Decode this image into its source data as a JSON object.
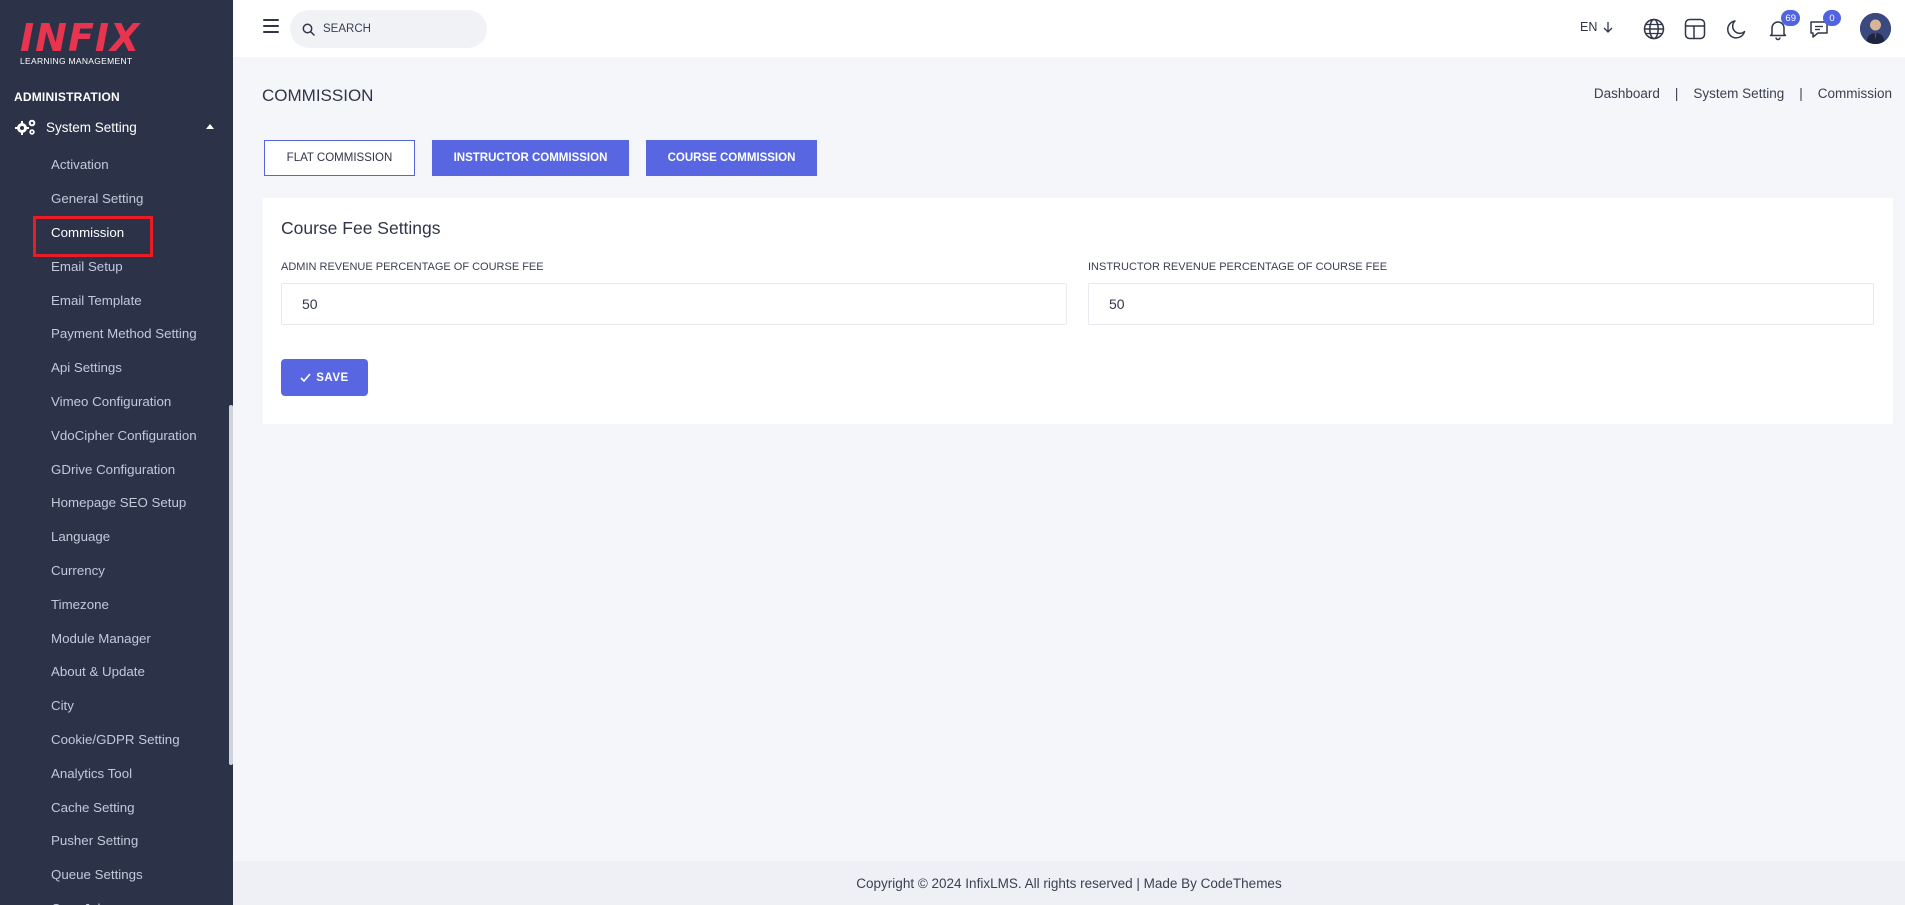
{
  "sidebar": {
    "logo_main": "INFIX",
    "logo_sub": "LEARNING MANAGEMENT",
    "section_title": "ADMINISTRATION",
    "parent_menu": "System Setting",
    "items": [
      {
        "label": "Activation"
      },
      {
        "label": "General Setting"
      },
      {
        "label": "Commission"
      },
      {
        "label": "Email Setup"
      },
      {
        "label": "Email Template"
      },
      {
        "label": "Payment Method Setting"
      },
      {
        "label": "Api Settings"
      },
      {
        "label": "Vimeo Configuration"
      },
      {
        "label": "VdoCipher Configuration"
      },
      {
        "label": "GDrive Configuration"
      },
      {
        "label": "Homepage SEO Setup"
      },
      {
        "label": "Language"
      },
      {
        "label": "Currency"
      },
      {
        "label": "Timezone"
      },
      {
        "label": "Module Manager"
      },
      {
        "label": "About & Update"
      },
      {
        "label": "City"
      },
      {
        "label": "Cookie/GDPR Setting"
      },
      {
        "label": "Analytics Tool"
      },
      {
        "label": "Cache Setting"
      },
      {
        "label": "Pusher Setting"
      },
      {
        "label": "Queue Settings"
      },
      {
        "label": "Cron Job"
      }
    ],
    "active_item": "Commission"
  },
  "header": {
    "search_placeholder": "SEARCH",
    "language": "EN",
    "notifications_count": "69",
    "messages_count": "0"
  },
  "page": {
    "title": "COMMISSION",
    "breadcrumb": [
      "Dashboard",
      "System Setting",
      "Commission"
    ],
    "breadcrumb_separator": "|",
    "tabs": [
      {
        "label": "FLAT COMMISSION"
      },
      {
        "label": "INSTRUCTOR COMMISSION"
      },
      {
        "label": "COURSE COMMISSION"
      }
    ]
  },
  "form": {
    "title": "Course Fee Settings",
    "admin_label": "ADMIN REVENUE PERCENTAGE OF COURSE FEE",
    "admin_value": "50",
    "instructor_label": "INSTRUCTOR REVENUE PERCENTAGE OF COURSE FEE",
    "instructor_value": "50",
    "save_label": "SAVE"
  },
  "footer": {
    "text": "Copyright © 2024 InfixLMS. All rights reserved | Made By CodeThemes"
  },
  "colors": {
    "sidebar_bg": "#2c3349",
    "accent": "#5867e1",
    "logo_red": "#e8344e",
    "highlight_red": "#e81c24"
  }
}
